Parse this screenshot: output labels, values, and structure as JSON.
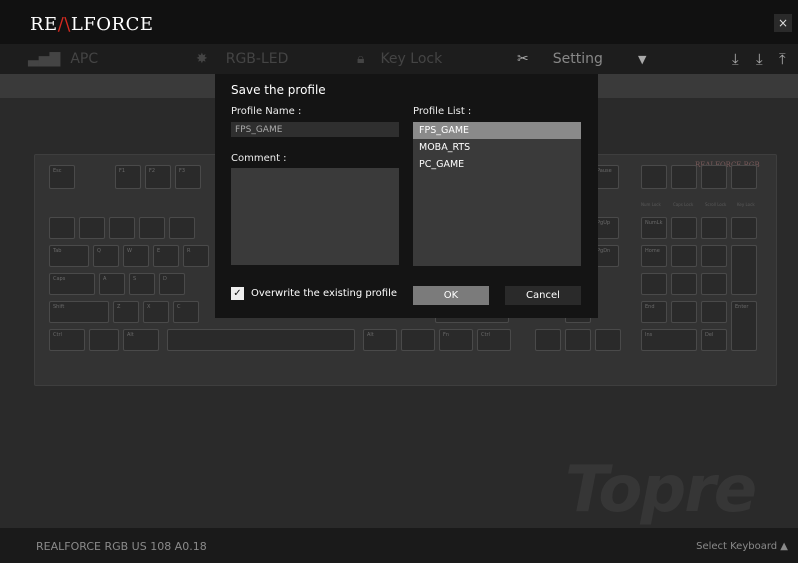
{
  "app": {
    "logo_prefix": "RE",
    "logo_slash": "/\\",
    "logo_suffix": "LFORCE",
    "close": "×"
  },
  "tabs": [
    {
      "label": "APC",
      "icon": "apc-icon"
    },
    {
      "label": "RGB-LED",
      "icon": "sun-icon"
    },
    {
      "label": "Key Lock",
      "icon": "lock-icon"
    },
    {
      "label": "Setting",
      "icon": "tools-icon"
    }
  ],
  "toolbar_icons": [
    "download-keyboard-icon",
    "download-icon",
    "upload-icon"
  ],
  "keyboard": {
    "brand": "REALFORCE RGB",
    "indicators": [
      "Num Lock",
      "Caps Lock",
      "Scroll Lock",
      "Key Lock"
    ],
    "keys": [
      "Esc",
      "F1",
      "F2",
      "F3",
      "Pause",
      "Tab",
      "Q",
      "W",
      "E",
      "R",
      "Caps",
      "A",
      "S",
      "D",
      "Shift",
      "Z",
      "X",
      "C",
      "Ctrl",
      "Alt",
      "Alt",
      "Fn",
      "Ctrl",
      "PgUp",
      "PgDn",
      "NumLk",
      "Enter",
      "Home",
      "End",
      "Del",
      "Ins"
    ]
  },
  "watermark": "Topre",
  "footer": {
    "model": "REALFORCE RGB US 108  A0.18",
    "select_keyboard": "Select Keyboard ▲"
  },
  "dialog": {
    "title": "Save the profile",
    "profile_name_label": "Profile Name :",
    "profile_name_value": "FPS_GAME",
    "profile_list_label": "Profile List :",
    "comment_label": "Comment :",
    "profiles": [
      "FPS_GAME",
      "MOBA_RTS",
      "PC_GAME"
    ],
    "selected_profile": "FPS_GAME",
    "overwrite_label": "Overwrite the existing profile",
    "overwrite_checked": true,
    "ok_label": "OK",
    "cancel_label": "Cancel"
  }
}
